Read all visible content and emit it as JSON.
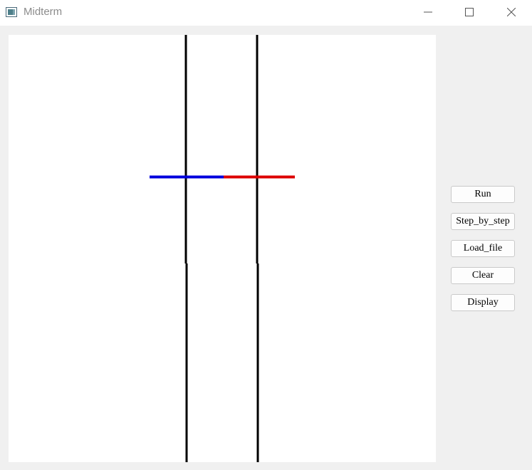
{
  "window": {
    "title": "Midterm",
    "icons": [
      "app-icon",
      "minimize-icon",
      "maximize-icon",
      "close-icon"
    ]
  },
  "sidebar": {
    "buttons": [
      {
        "id": "run",
        "label": "Run"
      },
      {
        "id": "step",
        "label": "Step_by_step"
      },
      {
        "id": "load",
        "label": "Load_file"
      },
      {
        "id": "clear",
        "label": "Clear"
      },
      {
        "id": "display",
        "label": "Display"
      }
    ]
  },
  "canvas": {
    "line_colors": {
      "black": "#000000",
      "blue": "#0000dd",
      "red": "#dd0000"
    }
  }
}
